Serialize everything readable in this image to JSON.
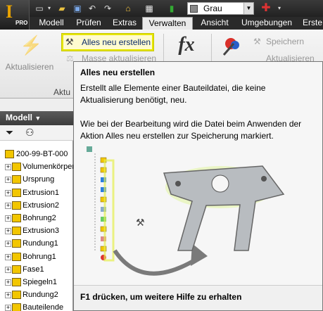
{
  "qat": {
    "style_combo_value": "Grau"
  },
  "tabs": [
    "Modell",
    "Prüfen",
    "Extras",
    "Verwalten",
    "Ansicht",
    "Umgebungen",
    "Erste"
  ],
  "ribbon": {
    "update_label": "Aktualisieren",
    "rebuild_all_label": "Alles neu erstellen",
    "mass_update_label": "Masse aktualisieren",
    "fx_label": "fx",
    "save_label": "Speichern",
    "update2_label": "Aktualisieren",
    "group_label": "Aktu"
  },
  "panel": {
    "title": "Modell",
    "tree": [
      {
        "label": "200-99-BT-000",
        "root": true
      },
      {
        "label": "Volumenkörper"
      },
      {
        "label": "Ursprung"
      },
      {
        "label": "Extrusion1"
      },
      {
        "label": "Extrusion2"
      },
      {
        "label": "Bohrung2"
      },
      {
        "label": "Extrusion3"
      },
      {
        "label": "Rundung1"
      },
      {
        "label": "Bohrung1"
      },
      {
        "label": "Fase1"
      },
      {
        "label": "Spiegeln1"
      },
      {
        "label": "Rundung2"
      },
      {
        "label": "Bauteilende"
      }
    ]
  },
  "tooltip": {
    "title": "Alles neu erstellen",
    "description": "Erstellt alle Elemente einer Bauteildatei, die keine Aktualisierung benötigt, neu.",
    "note": "Wie bei der Bearbeitung wird die Datei beim Anwenden der Aktion Alles neu erstellen zur Speicherung markiert.",
    "footer": "F1 drücken, um weitere Hilfe zu erhalten"
  },
  "colors": {
    "highlight": "#e6e600",
    "dark_bar": "#2a2a2a",
    "feature_icon": "#f2c600"
  }
}
